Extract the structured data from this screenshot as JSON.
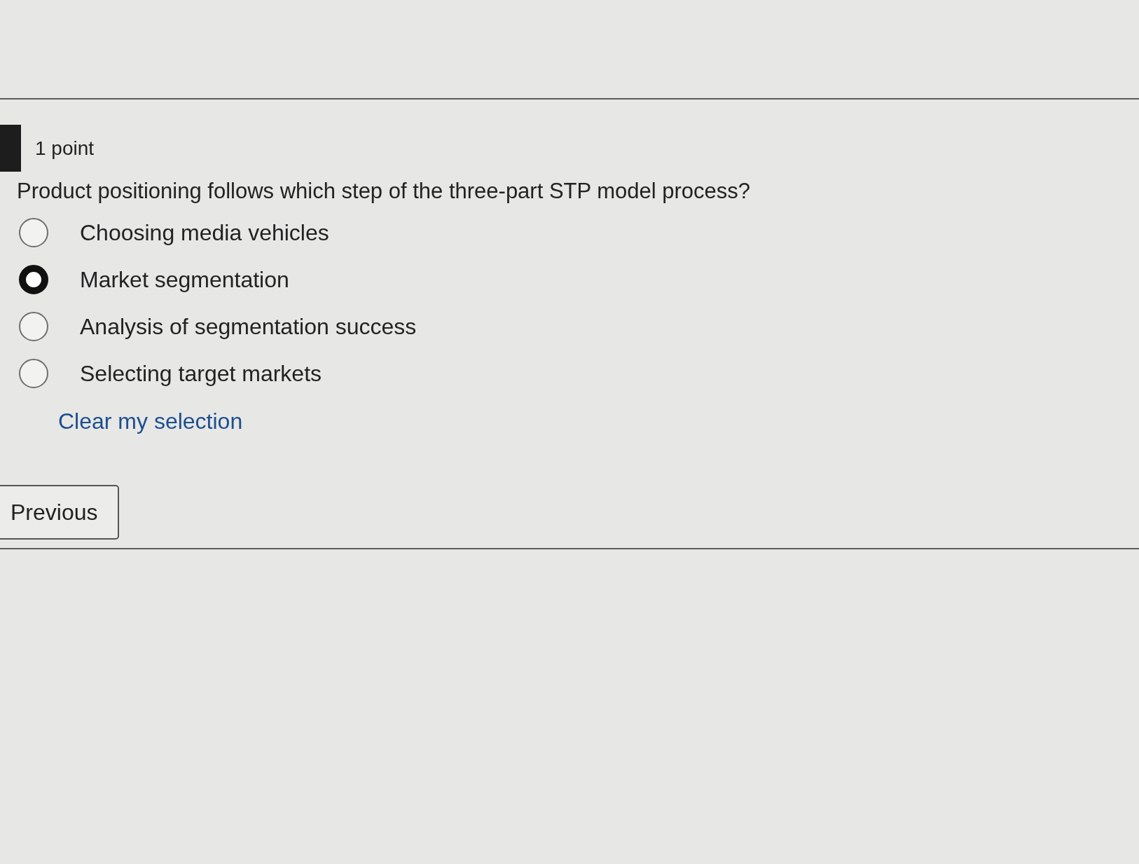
{
  "question": {
    "points": "1 point",
    "text": "Product positioning follows which step of the three-part STP model process?",
    "options": [
      {
        "label": "Choosing media vehicles",
        "selected": false
      },
      {
        "label": "Market segmentation",
        "selected": true
      },
      {
        "label": "Analysis of segmentation success",
        "selected": false
      },
      {
        "label": "Selecting target markets",
        "selected": false
      }
    ],
    "clear_link": "Clear my selection"
  },
  "navigation": {
    "previous_button": "Previous"
  }
}
